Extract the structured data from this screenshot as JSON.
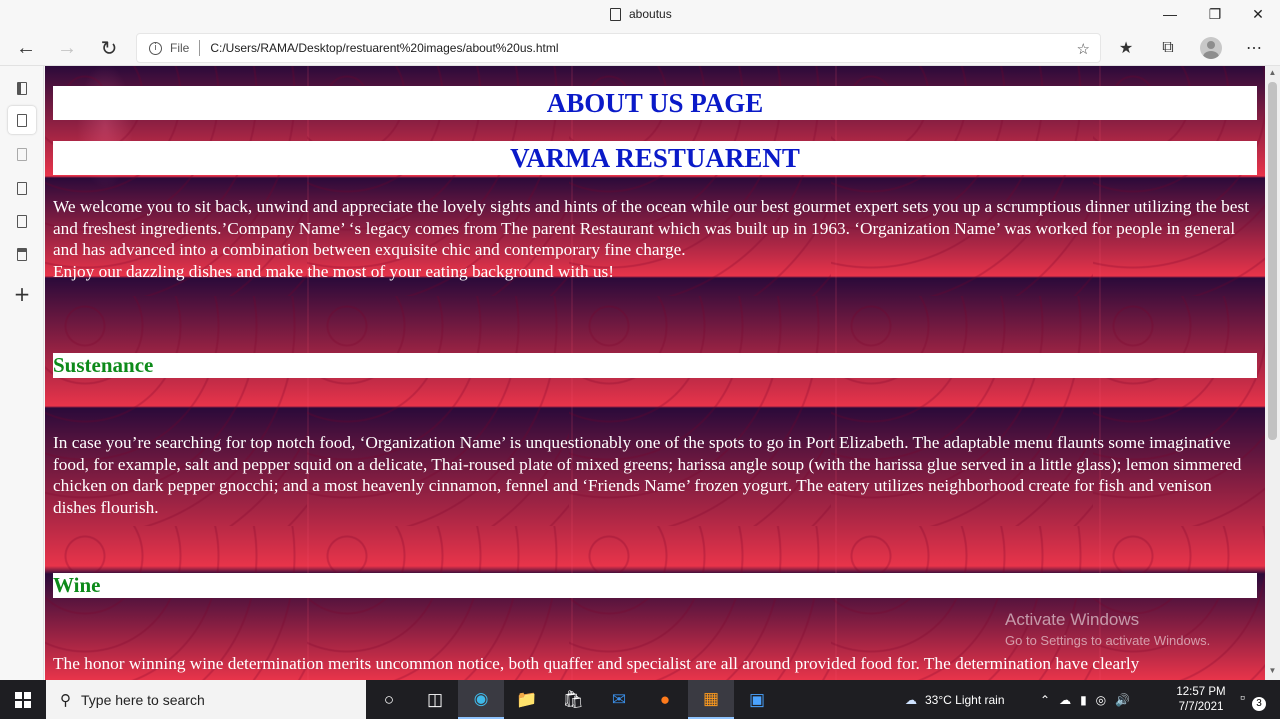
{
  "browser": {
    "tab_title": "aboutus",
    "address_scheme": "File",
    "address_url": "C:/Users/RAMA/Desktop/restuarent%20images/about%20us.html"
  },
  "page": {
    "title": "ABOUT US PAGE",
    "restaurant_name": "VARMA RESTUARENT",
    "intro": "We welcome you to sit back, unwind and appreciate the lovely sights and hints of the ocean while our best gourmet expert sets you up a scrumptious dinner utilizing the best and freshest ingredients.’Company Name’ ‘s legacy comes from The parent Restaurant which was built up in 1963. ‘Organization Name’ was worked for people in general and has advanced into a combination between exquisite chic and contemporary fine charge.",
    "intro_line2": "Enjoy our dazzling dishes and make the most of your eating background with us!",
    "section1_heading": "Sustenance",
    "section1_text": "In case you’re searching for top notch food, ‘Organization Name’ is unquestionably one of the spots to go in Port Elizabeth. The adaptable menu flaunts some imaginative food, for example, salt and pepper squid on a delicate, Thai-roused plate of mixed greens; harissa angle soup (with the harissa glue served in a little glass); lemon simmered chicken on dark pepper gnocchi; and a most heavenly cinnamon, fennel and ‘Friends Name’ frozen yogurt. The eatery utilizes neighborhood create for fish and venison dishes flourish.",
    "section2_heading": "Wine",
    "section2_text": "The honor winning wine determination merits uncommon notice, both quaffer and specialist are all around provided food for. The determination have clearly"
  },
  "watermark": {
    "line1": "Activate Windows",
    "line2": "Go to Settings to activate Windows."
  },
  "taskbar": {
    "search_placeholder": "Type here to search",
    "weather": "33°C  Light rain",
    "time": "12:57 PM",
    "date": "7/7/2021",
    "notification_count": "3"
  }
}
